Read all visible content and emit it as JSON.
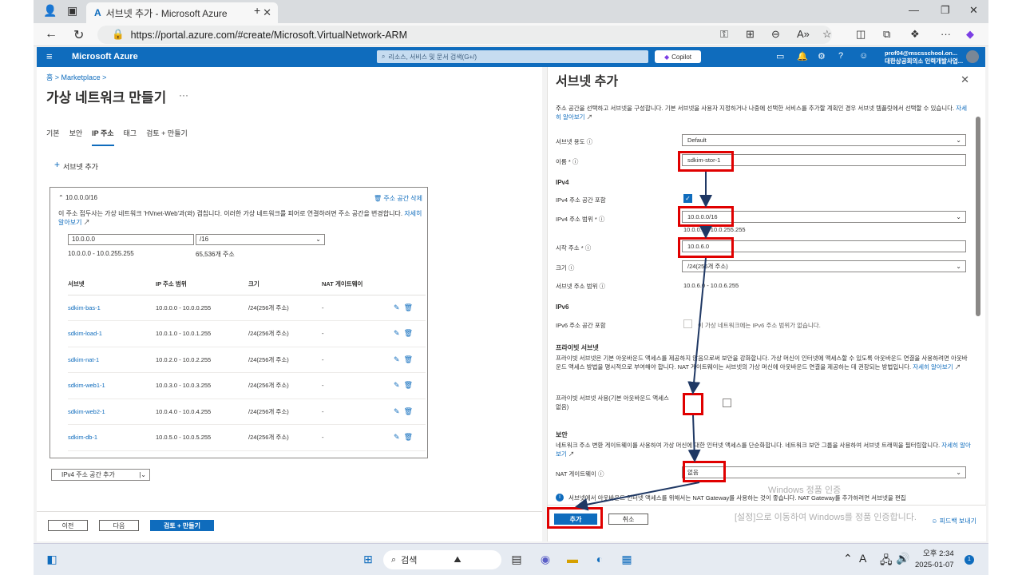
{
  "browser": {
    "tab_title": "서브넷 추가 - Microsoft Azure",
    "url": "https://portal.azure.com/#create/Microsoft.VirtualNetwork-ARM"
  },
  "azure": {
    "brand": "Microsoft Azure",
    "search_placeholder": "리소스, 서비스 및 문서 검색(G+/)",
    "copilot": "Copilot",
    "account_email": "prof04@mscsschool.on...",
    "account_org": "대한상공회의소 인력개발사업..."
  },
  "left": {
    "breadcrumb_home": "홈",
    "breadcrumb_marketplace": "Marketplace",
    "title": "가상 네트워크 만들기",
    "tabs": [
      "기본",
      "보안",
      "IP 주소",
      "태그",
      "검토 + 만들기"
    ],
    "add_subnet": "서브넷 추가",
    "space_header": "10.0.0.0/16",
    "delete_space": "주소 공간 삭제",
    "overlap_msg": "이 주소 접두사는 가상 네트워크 'HVnet-Web'과(와) 겹칩니다. 이러한 가상 네트워크를 피어로 연결하려면 주소 공간을 변경합니다.",
    "learn_more": "자세히 알아보기",
    "ip_value": "10.0.0.0",
    "cidr_value": "/16",
    "range": "10.0.0.0 - 10.0.255.255",
    "count": "65,536개 주소",
    "columns": [
      "서브넷",
      "IP 주소 범위",
      "크기",
      "NAT 게이트웨이"
    ],
    "rows": [
      {
        "name": "sdkim-bas-1",
        "range": "10.0.0.0 - 10.0.0.255",
        "size": "/24(256개 주소)",
        "nat": "-"
      },
      {
        "name": "sdkim-load-1",
        "range": "10.0.1.0 - 10.0.1.255",
        "size": "/24(256개 주소)",
        "nat": "-"
      },
      {
        "name": "sdkim-nat-1",
        "range": "10.0.2.0 - 10.0.2.255",
        "size": "/24(256개 주소)",
        "nat": "-"
      },
      {
        "name": "sdkim-web1-1",
        "range": "10.0.3.0 - 10.0.3.255",
        "size": "/24(256개 주소)",
        "nat": "-"
      },
      {
        "name": "sdkim-web2-1",
        "range": "10.0.4.0 - 10.0.4.255",
        "size": "/24(256개 주소)",
        "nat": "-"
      },
      {
        "name": "sdkim-db-1",
        "range": "10.0.5.0 - 10.0.5.255",
        "size": "/24(256개 주소)",
        "nat": "-"
      }
    ],
    "add_ipv4_space": "IPv4 주소 공간 추가",
    "btn_prev": "이전",
    "btn_next": "다음",
    "btn_review": "검토 + 만들기"
  },
  "panel": {
    "title": "서브넷 추가",
    "desc": "주소 공간을 선택하고 서브넷을 구성합니다. 기본 서브넷을 사용자 지정하거나 나중에 선택한 서비스를 추가할 계획인 경우 서브넷 템플릿에서 선택할 수 있습니다.",
    "learn_more": "자세히 알아보기",
    "purpose_label": "서브넷 용도",
    "purpose_value": "Default",
    "name_label": "이름 *",
    "name_value": "sdkim-stor-1",
    "ipv4_heading": "IPv4",
    "ipv4_include_label": "IPv4 주소 공간 포함",
    "ipv4_range_label": "IPv4 주소 범위 *",
    "ipv4_range_value": "10.0.0.0/16",
    "ipv4_range_hint": "10.0.0.0 - 10.0.255.255",
    "start_label": "시작 주소 *",
    "start_value": "10.0.6.0",
    "size_label": "크기",
    "size_value": "/24(256개 주소)",
    "subnet_range_label": "서브넷 주소 범위",
    "subnet_range_value": "10.0.6.0 - 10.0.6.255",
    "ipv6_heading": "IPv6",
    "ipv6_include_label": "IPv6 주소 공간 포함",
    "ipv6_note": "이 가상 네트워크에는 IPv6 주소 범위가 없습니다.",
    "private_heading": "프라이빗 서브넷",
    "private_desc": "프라이빗 서브넷은 기본 아웃바운드 액세스를 제공하지 않음으로써 보안을 강화합니다. 가상 머신이 인터넷에 액세스할 수 있도록 아웃바운드 연결을 사용하려면 아웃바운드 액세스 방법을 명시적으로 부여해야 합니다. NAT 게이트웨이는 서브넷의 가상 머신에 아웃바운드 연결을 제공하는 데 권장되는 방법입니다.",
    "private_learn": "자세히 알아보기",
    "private_enable_label": "프라이빗 서브넷 사용(기본 아웃바운드 액세스 없음)",
    "security_heading": "보안",
    "security_desc": "네트워크 주소 변환 게이트웨이를 사용하여 가상 머신에 대한 인터넷 액세스를 단순화합니다. 네트워크 보안 그룹을 사용하여 서브넷 트래픽을 필터링합니다.",
    "security_learn": "자세히 알아보기",
    "nat_label": "NAT 게이트웨이",
    "nat_value": "없음",
    "info_text": "서브넷에서 아웃바운드 인터넷 액세스를 위해서는 NAT Gateway를 사용하는 것이 좋습니다. NAT Gateway를 추가하려면 서브넷을 편집",
    "btn_add": "추가",
    "btn_cancel": "취소",
    "feedback": "피드백 보내기",
    "watermark1": "Windows 정품 인증",
    "watermark2": "[설정]으로 이동하여 Windows를 정품 인증합니다."
  },
  "taskbar": {
    "search": "검색",
    "time": "오후 2:34",
    "date": "2025-01-07",
    "notif_count": "1",
    "lang": "A"
  },
  "colors": {
    "accent": "#0f6cbd",
    "annotation": "#e00000"
  }
}
